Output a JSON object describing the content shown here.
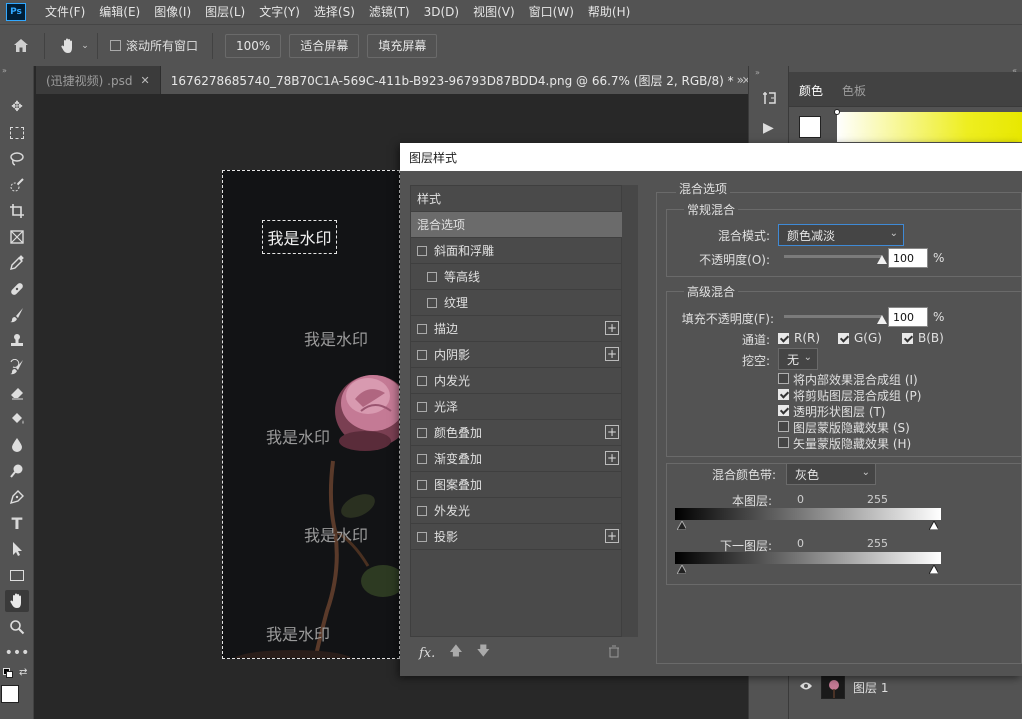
{
  "menubar": {
    "logo": "Ps",
    "items": [
      "文件(F)",
      "编辑(E)",
      "图像(I)",
      "图层(L)",
      "文字(Y)",
      "选择(S)",
      "滤镜(T)",
      "3D(D)",
      "视图(V)",
      "窗口(W)",
      "帮助(H)"
    ]
  },
  "options": {
    "scroll_all_label": "滚动所有窗口",
    "zoom_label": "100%",
    "fit_screen_label": "适合屏幕",
    "fill_screen_label": "填充屏幕"
  },
  "tabs": [
    {
      "label": "(迅捷视频) .psd",
      "close": "✕",
      "active": false
    },
    {
      "label": "1676278685740_78B70C1A-569C-411b-B923-96793D87BDD4.png @ 66.7% (图层 2, RGB/8) *",
      "close": "✕",
      "active": true
    }
  ],
  "tabs_overflow": "»",
  "canvas": {
    "watermark_selected": "我是水印",
    "watermarks": [
      "我是水印",
      "我是水印",
      "我是水印",
      "我是水印"
    ]
  },
  "right_panel": {
    "tab_color": "颜色",
    "tab_swatches": "色板",
    "layer_name": "图层 1"
  },
  "dialog": {
    "title": "图层样式",
    "style_list": [
      {
        "label": "样式",
        "checkbox": false,
        "plus": false,
        "selected": false,
        "indent": false
      },
      {
        "label": "混合选项",
        "checkbox": false,
        "plus": false,
        "selected": true,
        "indent": false
      },
      {
        "label": "斜面和浮雕",
        "checkbox": true,
        "plus": false,
        "selected": false,
        "indent": false
      },
      {
        "label": "等高线",
        "checkbox": true,
        "plus": false,
        "selected": false,
        "indent": true
      },
      {
        "label": "纹理",
        "checkbox": true,
        "plus": false,
        "selected": false,
        "indent": true
      },
      {
        "label": "描边",
        "checkbox": true,
        "plus": true,
        "selected": false,
        "indent": false
      },
      {
        "label": "内阴影",
        "checkbox": true,
        "plus": true,
        "selected": false,
        "indent": false
      },
      {
        "label": "内发光",
        "checkbox": true,
        "plus": false,
        "selected": false,
        "indent": false
      },
      {
        "label": "光泽",
        "checkbox": true,
        "plus": false,
        "selected": false,
        "indent": false
      },
      {
        "label": "颜色叠加",
        "checkbox": true,
        "plus": true,
        "selected": false,
        "indent": false
      },
      {
        "label": "渐变叠加",
        "checkbox": true,
        "plus": true,
        "selected": false,
        "indent": false
      },
      {
        "label": "图案叠加",
        "checkbox": true,
        "plus": false,
        "selected": false,
        "indent": false
      },
      {
        "label": "外发光",
        "checkbox": true,
        "plus": false,
        "selected": false,
        "indent": false
      },
      {
        "label": "投影",
        "checkbox": true,
        "plus": true,
        "selected": false,
        "indent": false
      }
    ],
    "footer_fx": "fx.",
    "blending_options_title": "混合选项",
    "general_blending": {
      "title": "常规混合",
      "mode_label": "混合模式:",
      "mode_value": "颜色减淡",
      "opacity_label": "不透明度(O):",
      "opacity_value": "100",
      "opacity_level": 1.0,
      "unit": "%"
    },
    "advanced_blending": {
      "title": "高级混合",
      "fill_opacity_label": "填充不透明度(F):",
      "fill_opacity_value": "100",
      "fill_opacity_level": 1.0,
      "unit": "%",
      "channels_label": "通道:",
      "channels": [
        {
          "label": "R(R)",
          "checked": true
        },
        {
          "label": "G(G)",
          "checked": true
        },
        {
          "label": "B(B)",
          "checked": true
        }
      ],
      "knockout_label": "挖空:",
      "knockout_value": "无",
      "options": [
        {
          "label": "将内部效果混合成组 (I)",
          "checked": false
        },
        {
          "label": "将剪贴图层混合成组 (P)",
          "checked": true
        },
        {
          "label": "透明形状图层 (T)",
          "checked": true
        },
        {
          "label": "图层蒙版隐藏效果 (S)",
          "checked": false
        },
        {
          "label": "矢量蒙版隐藏效果 (H)",
          "checked": false
        }
      ]
    },
    "blend_if": {
      "label": "混合颜色带:",
      "value": "灰色",
      "this_layer_label": "本图层:",
      "this_layer_min": "0",
      "this_layer_max": "255",
      "underlying_label": "下一图层:",
      "underlying_min": "0",
      "underlying_max": "255"
    }
  }
}
